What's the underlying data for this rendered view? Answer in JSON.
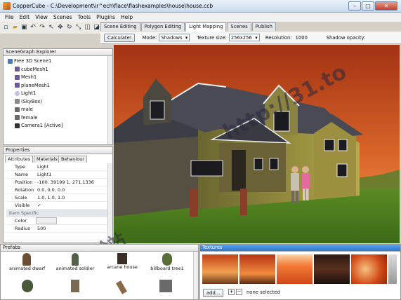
{
  "window": {
    "title": "CopperCube - C:\\Development\\ir^ech\\flace\\flashexamples\\house\\house.ccb",
    "controls": [
      "–",
      "□",
      "✕"
    ]
  },
  "menu": [
    "File",
    "Edit",
    "View",
    "Scenes",
    "Tools",
    "Plugins",
    "Help"
  ],
  "tabs": [
    {
      "label": "Scene Editing",
      "active": false
    },
    {
      "label": "Polygon Editing",
      "active": false
    },
    {
      "label": "Light Mapping",
      "active": true
    },
    {
      "label": "Scenes",
      "active": false
    },
    {
      "label": "Publish",
      "active": false
    }
  ],
  "lightmap": {
    "calculate_label": "Calculate!",
    "mode_label": "Mode:",
    "mode_value": "Shadows",
    "texture_size_label": "Texture size:",
    "texture_size_value": "256x256",
    "resolution_label": "Resolution:",
    "resolution_value": "1000",
    "shadow_opacity_label": "Shadow opacity:"
  },
  "scenegraph": {
    "title": "SceneGraph Explorer",
    "items": [
      {
        "label": "Free 3D Scene1",
        "icon": "scene-icon",
        "indent": 0
      },
      {
        "label": "cubeMesh1",
        "icon": "mesh-icon",
        "indent": 1
      },
      {
        "label": "Mesh1",
        "icon": "mesh-icon",
        "indent": 1
      },
      {
        "label": "planeMesh1",
        "icon": "mesh-icon",
        "indent": 1
      },
      {
        "label": "Light1",
        "icon": "light-icon",
        "indent": 1
      },
      {
        "label": "(SkyBox)",
        "icon": "skybox-icon",
        "indent": 1
      },
      {
        "label": "male",
        "icon": "character-icon",
        "indent": 1
      },
      {
        "label": "female",
        "icon": "character-icon",
        "indent": 1
      },
      {
        "label": "Camera1 [Active]",
        "icon": "camera-icon",
        "indent": 1
      }
    ]
  },
  "properties": {
    "title": "Properties",
    "tabs": [
      "Attributes",
      "Materials",
      "Behaviour"
    ],
    "rows": [
      {
        "key": "Type",
        "value": "Light",
        "section": false
      },
      {
        "key": "Name",
        "value": "Light1",
        "section": false
      },
      {
        "key": "Position",
        "value": "-100. 39199 1, 271.1336",
        "section": false
      },
      {
        "key": "Rotation",
        "value": "0.0, 0.0, 0.0",
        "section": false
      },
      {
        "key": "Scale",
        "value": "1.0, 1.0, 1.0",
        "section": false
      },
      {
        "key": "Visible",
        "value": "✓",
        "section": false
      },
      {
        "key": "Item Specific",
        "value": "",
        "section": true
      },
      {
        "key": "Color",
        "value": "",
        "section": false
      },
      {
        "key": "Radius",
        "value": "500",
        "section": false
      },
      {
        "key": "",
        "value": "",
        "section": false
      }
    ]
  },
  "prefabs": {
    "title": "Prefabs",
    "items": [
      "animated dwarf",
      "animated soldier",
      "arcane house",
      "billboard tree1"
    ]
  },
  "textures": {
    "title": "Textures",
    "add_label": "add...",
    "status": "none selected"
  },
  "watermark": {
    "line1": "http://31.to",
    "line2": "xyz軟體補給站"
  },
  "colors": {
    "active_panel_header": "#3d8bdd",
    "sky_top": "#b23a14",
    "sky_bottom": "#f09040",
    "grass": "#4a7a1c",
    "siding": "#a39a42",
    "roof": "#4a4a55"
  }
}
